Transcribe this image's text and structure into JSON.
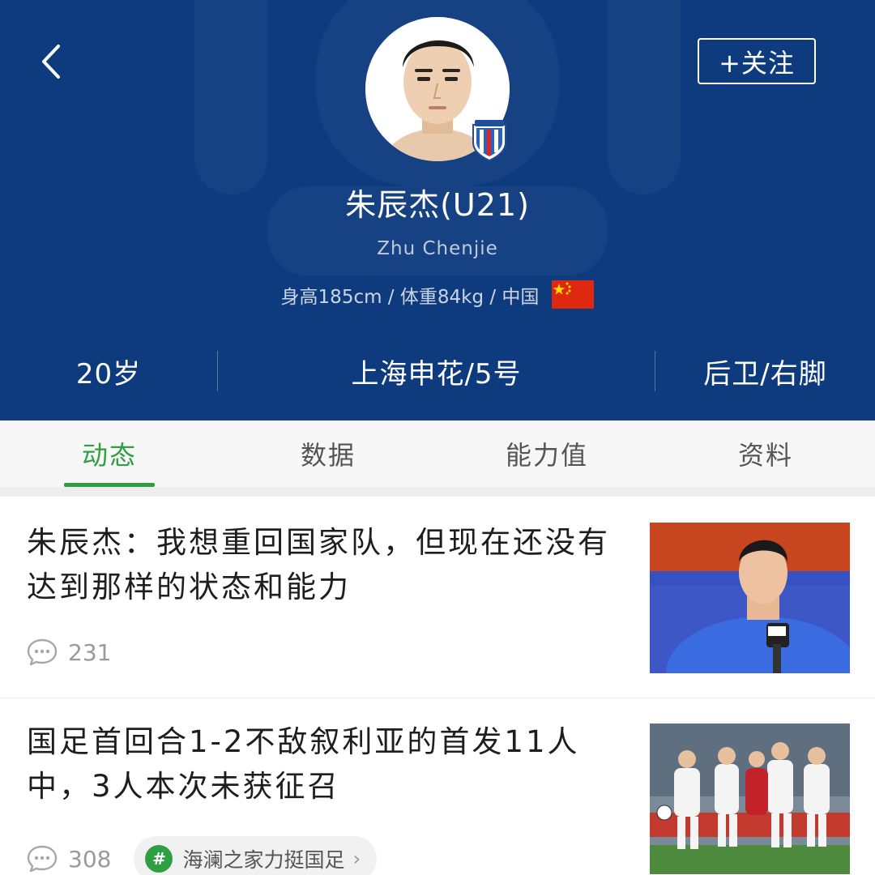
{
  "header": {
    "back_icon": "chevron-left-icon",
    "follow_label": "+关注",
    "name": "朱辰杰(U21)",
    "name_en": "Zhu Chenjie",
    "meta": "身高185cm / 体重84kg / 中国",
    "flag_icon": "china-flag-icon",
    "stats": [
      "20岁",
      "上海申花/5号",
      "后卫/右脚"
    ],
    "bg_color": "#0e3b7e"
  },
  "tabs": [
    {
      "label": "动态",
      "active": true
    },
    {
      "label": "数据",
      "active": false
    },
    {
      "label": "能力值",
      "active": false
    },
    {
      "label": "资料",
      "active": false
    }
  ],
  "accent_color": "#2ea043",
  "news": [
    {
      "title": "朱辰杰：我想重回国家队，但现在还没有达到那样的状态和能力",
      "comments": "231"
    },
    {
      "title": "国足首回合1-2不敌叙利亚的首发11人中，3人本次未获征召",
      "comments": "308",
      "topic": "海澜之家力挺国足"
    }
  ]
}
